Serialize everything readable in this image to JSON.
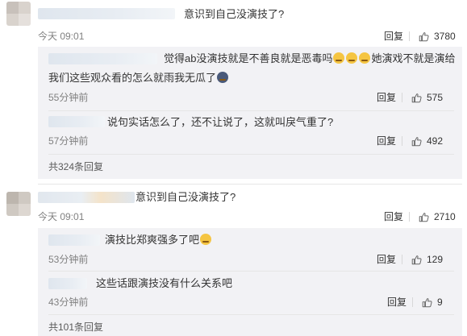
{
  "comments": [
    {
      "text": "意识到自己没演技了?",
      "time": "今天 09:01",
      "reply_label": "回复",
      "likes": "3780",
      "replies": [
        {
          "text_line1": "觉得ab没演技就是不善良就是恶毒吗",
          "text_line1_tail": "她演戏不就是演给",
          "text_line2": "我们这些观众看的怎么就雨我无瓜了",
          "time": "55分钟前",
          "reply_label": "回复",
          "likes": "575"
        },
        {
          "text": "说句实话怎么了，还不让说了，这就叫戾气重了?",
          "time": "57分钟前",
          "reply_label": "回复",
          "likes": "492"
        }
      ],
      "more_replies": "共324条回复"
    },
    {
      "text": "意识到自己没演技了?",
      "time": "今天 09:01",
      "reply_label": "回复",
      "likes": "2710",
      "replies": [
        {
          "text": "演技比郑爽强多了吧",
          "time": "53分钟前",
          "reply_label": "回复",
          "likes": "129"
        },
        {
          "text": "这些话跟演技没有什么关系吧",
          "time": "43分钟前",
          "reply_label": "回复",
          "likes": "9"
        }
      ],
      "more_replies": "共101条回复"
    }
  ]
}
